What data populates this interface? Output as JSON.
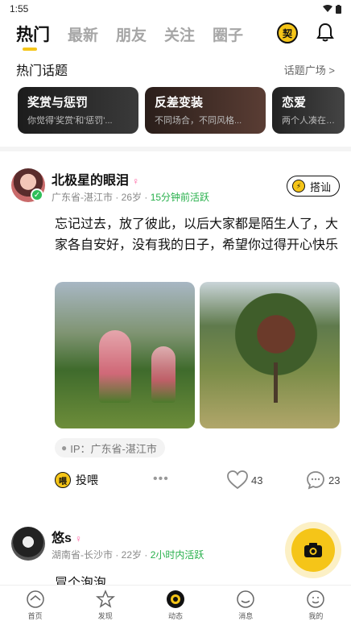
{
  "status_bar": {
    "time": "1:55"
  },
  "top_tabs": [
    {
      "label": "热门",
      "active": true
    },
    {
      "label": "最新",
      "active": false
    },
    {
      "label": "朋友",
      "active": false
    },
    {
      "label": "关注",
      "active": false
    },
    {
      "label": "圈子",
      "active": false
    }
  ],
  "header": {
    "contract_label": "契"
  },
  "hot_topics": {
    "title": "热门话题",
    "link": "话题广场 >",
    "items": [
      {
        "name": "奖赏与惩罚",
        "desc": "你觉得'奖赏'和'惩罚'..."
      },
      {
        "name": "反差变装",
        "desc": "不同场合，不同风格..."
      },
      {
        "name": "恋爱",
        "desc": "两个人凑在一起..."
      }
    ]
  },
  "posts": [
    {
      "username": "北极星的眼泪",
      "location": "广东省-湛江市",
      "age": "26岁",
      "active": "15分钟前活跃",
      "greet_label": "搭讪",
      "text": "忘记过去，放了彼此，以后大家都是陌生人了，大家各自安好，没有我的日子，希望你过得开心快乐",
      "ip": "IP：广东省-湛江市",
      "feed_label": "投喂",
      "feed_coin": "喂",
      "likes": "43",
      "comments": "23"
    },
    {
      "username": "悠s",
      "location": "湖南省-长沙市",
      "age": "22岁",
      "active": "2小时内活跃",
      "text": "冒个泡泡"
    }
  ],
  "bottom_nav": [
    {
      "label": "首页",
      "icon": "home-icon"
    },
    {
      "label": "发现",
      "icon": "discover-icon"
    },
    {
      "label": "动态",
      "icon": "moments-icon"
    },
    {
      "label": "消息",
      "icon": "message-icon"
    },
    {
      "label": "我的",
      "icon": "profile-icon"
    }
  ],
  "colors": {
    "accent": "#f5c518",
    "active_green": "#27b04b",
    "female_pink": "#ff5fa0"
  }
}
